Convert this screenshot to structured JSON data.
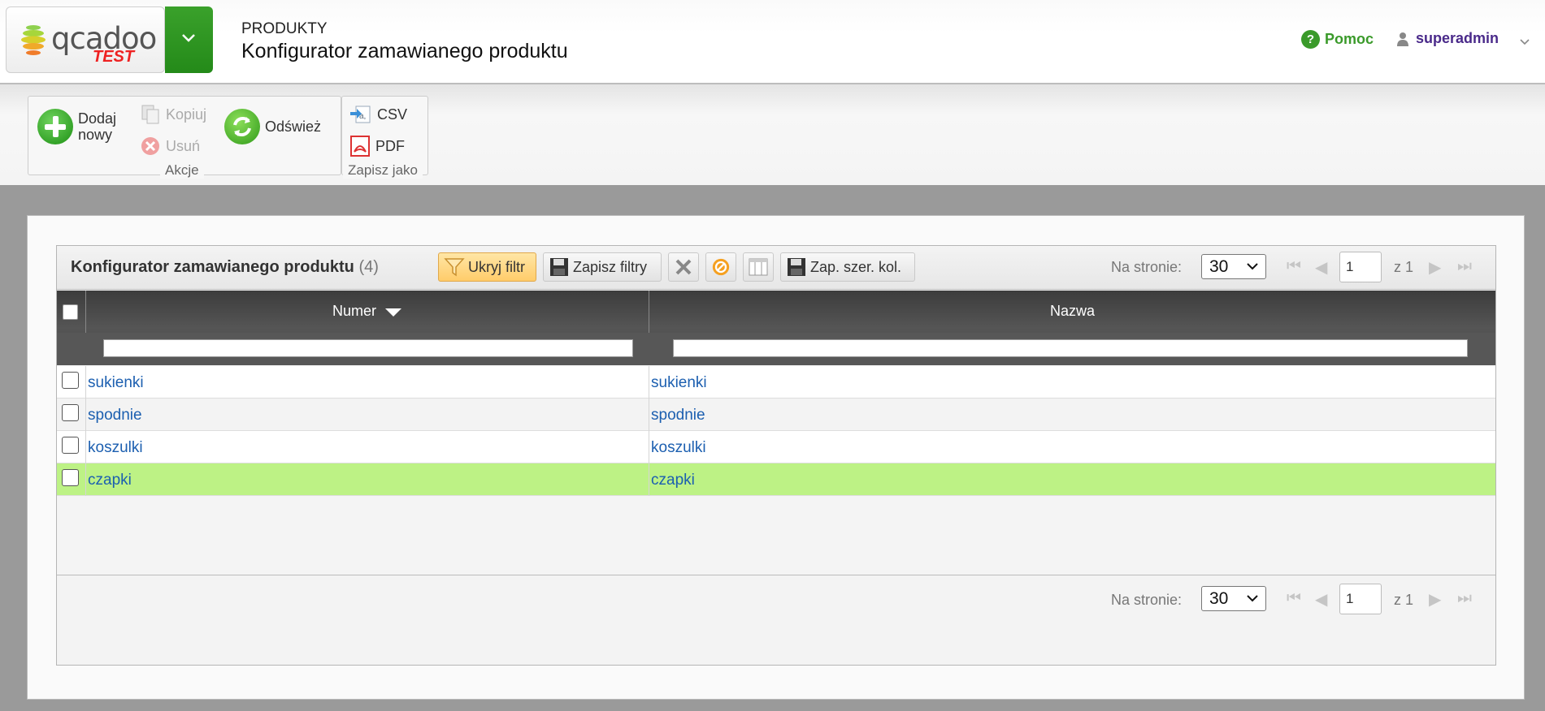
{
  "header": {
    "logo_text": "qcadoo",
    "logo_badge": "TEST",
    "section": "PRODUKTY",
    "title": "Konfigurator zamawianego produktu",
    "help": "Pomoc",
    "user": "superadmin"
  },
  "ribbon": {
    "actions_group": "Akcje",
    "add_line1": "Dodaj",
    "add_line2": "nowy",
    "copy": "Kopiuj",
    "delete": "Usuń",
    "refresh": "Odśwież",
    "export_group": "Zapisz jako",
    "csv": "CSV",
    "pdf": "PDF"
  },
  "grid": {
    "title": "Konfigurator zamawianego produktu",
    "count": "(4)",
    "hide_filter": "Ukryj filtr",
    "save_filters": "Zapisz filtry",
    "save_col_width": "Zap. szer. kol.",
    "per_page_label": "Na stronie:",
    "per_page_value": "30",
    "page_value": "1",
    "page_of": "z 1",
    "columns": [
      "Numer",
      "Nazwa"
    ],
    "rows": [
      {
        "number": "sukienki",
        "name": "sukienki",
        "selected": false
      },
      {
        "number": "spodnie",
        "name": "spodnie",
        "selected": false
      },
      {
        "number": "koszulki",
        "name": "koszulki",
        "selected": false
      },
      {
        "number": "czapki",
        "name": "czapki",
        "selected": true
      }
    ]
  },
  "colors": {
    "accent_green": "#2a9a1e",
    "link_blue": "#1c5fb0",
    "selected_row": "#bdf285",
    "alt_row": "#f3f3f3"
  }
}
